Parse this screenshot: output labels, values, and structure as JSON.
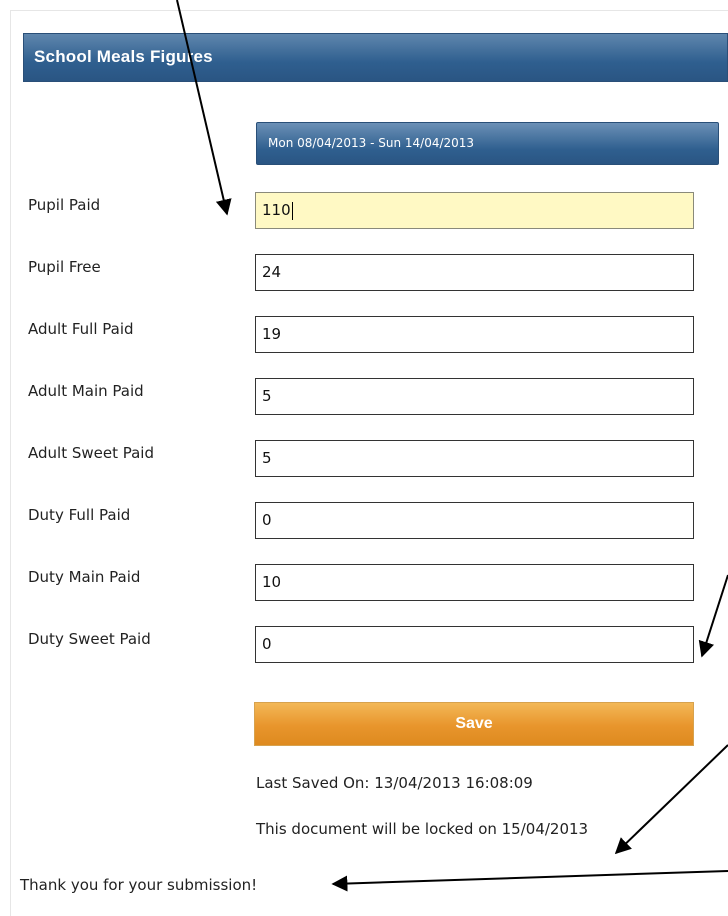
{
  "header": {
    "title": "School Meals Figures"
  },
  "week": {
    "range": "Mon 08/04/2013 - Sun 14/04/2013"
  },
  "rows": [
    {
      "label": "Pupil Paid",
      "value": "110"
    },
    {
      "label": "Pupil Free",
      "value": "24"
    },
    {
      "label": "Adult Full Paid",
      "value": "19"
    },
    {
      "label": "Adult Main Paid",
      "value": "5"
    },
    {
      "label": "Adult Sweet Paid",
      "value": "5"
    },
    {
      "label": "Duty Full Paid",
      "value": "0"
    },
    {
      "label": "Duty Main Paid",
      "value": "10"
    },
    {
      "label": "Duty Sweet Paid",
      "value": "0"
    }
  ],
  "save": {
    "label": "Save"
  },
  "status": {
    "last_saved": "Last Saved On: 13/04/2013 16:08:09",
    "lock_notice": "This document will be locked on 15/04/2013"
  },
  "thanks": "Thank you for your submission!",
  "colors": {
    "header_blue": "#2f5f8f",
    "save_orange": "#e8952c",
    "active_field": "#fff9c4"
  }
}
